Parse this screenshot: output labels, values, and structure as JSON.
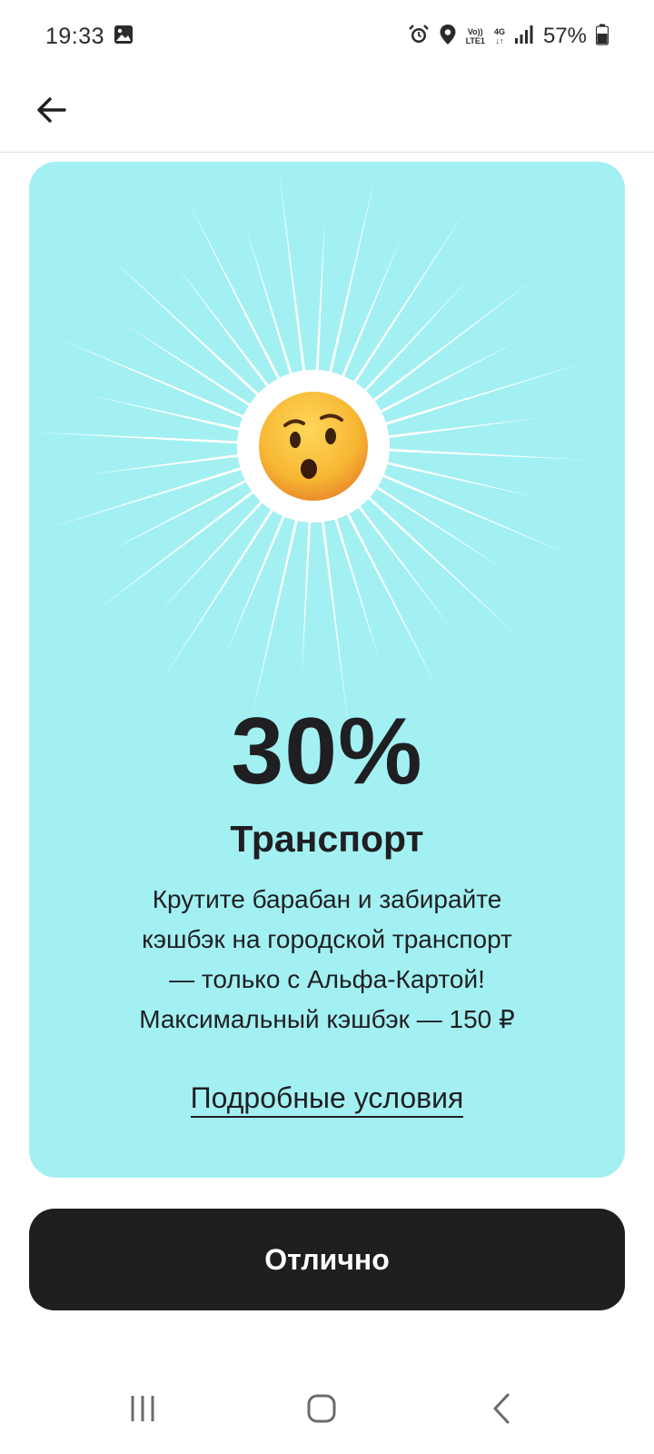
{
  "status_bar": {
    "time": "19:33",
    "network_top": "Vo))",
    "network_bottom": "LTE1",
    "network_type": "4G",
    "battery": "57%",
    "icons": [
      "image-icon",
      "alarm-icon",
      "location-icon",
      "volte-icon",
      "data-arrows-icon",
      "signal-icon",
      "battery-icon"
    ]
  },
  "app_bar": {
    "back_icon": "arrow-left-icon"
  },
  "promo": {
    "percent": "30%",
    "category": "Транспорт",
    "description_lines": [
      "Крутите барабан и забирайте",
      "кэшбэк на городской транспорт",
      "— только с Альфа-Картой!",
      "Максимальный кэшбэк — 150 ₽"
    ],
    "terms_link": "Подробные условия",
    "emoji": "hushed-face-raised-eyebrow",
    "background_color": "#a3f0f2"
  },
  "button": {
    "label": "Отлично",
    "color": "#1f1f22"
  },
  "nav_bar": {
    "icons": [
      "recents-icon",
      "home-icon",
      "back-icon"
    ]
  }
}
